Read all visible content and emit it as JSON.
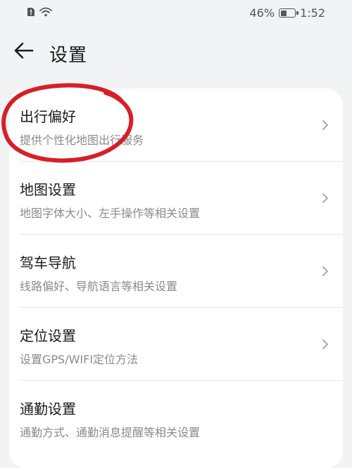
{
  "status_bar": {
    "battery_percent": "46%",
    "battery_level": 0.46,
    "time": "1:52",
    "icons": [
      "sim-alert-icon",
      "wifi-icon",
      "battery-icon"
    ]
  },
  "header": {
    "title": "设置",
    "back_icon": "arrow-left-icon"
  },
  "settings": {
    "items": [
      {
        "title": "出行偏好",
        "subtitle": "提供个性化地图出行服务"
      },
      {
        "title": "地图设置",
        "subtitle": "地图字体大小、左手操作等相关设置"
      },
      {
        "title": "驾车导航",
        "subtitle": "线路偏好、导航语言等相关设置"
      },
      {
        "title": "定位设置",
        "subtitle": "设置GPS/WIFI定位方法"
      },
      {
        "title": "通勤设置",
        "subtitle": "通勤方式、通勤消息提醒等相关设置"
      }
    ]
  },
  "colors": {
    "background": "#f1f3f5",
    "card": "#ffffff",
    "annotation": "#d61f26",
    "subtitle": "#8a8a8a"
  }
}
